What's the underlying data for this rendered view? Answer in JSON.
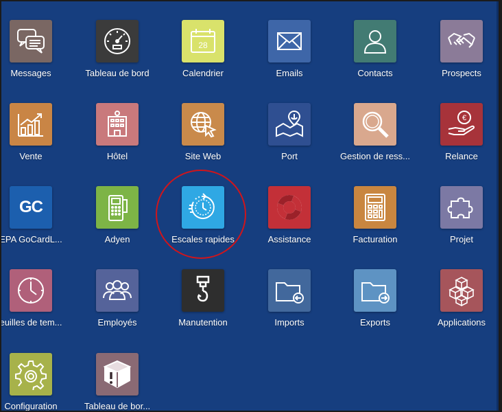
{
  "apps": [
    {
      "label": "Messages",
      "icon": "messages-icon",
      "color": "#7a6763"
    },
    {
      "label": "Tableau de bord",
      "icon": "dashboard-gauge-icon",
      "color": "#3b3b3b"
    },
    {
      "label": "Calendrier",
      "icon": "calendar-icon",
      "color": "#d9e26b",
      "calendar_day": "28"
    },
    {
      "label": "Emails",
      "icon": "email-envelope-icon",
      "color": "#3e66a8"
    },
    {
      "label": "Contacts",
      "icon": "contact-person-icon",
      "color": "#427b73"
    },
    {
      "label": "Prospects",
      "icon": "handshake-icon",
      "color": "#8b7b98"
    },
    {
      "label": "Vente",
      "icon": "sales-chart-icon",
      "color": "#c98545"
    },
    {
      "label": "Hôtel",
      "icon": "hotel-building-icon",
      "color": "#c9797c"
    },
    {
      "label": "Site Web",
      "icon": "globe-cursor-icon",
      "color": "#c98a4b"
    },
    {
      "label": "Port",
      "icon": "port-map-anchor-icon",
      "color": "#2f4f91"
    },
    {
      "label": "Gestion de ress...",
      "icon": "magnifier-icon",
      "color": "#d9a88e"
    },
    {
      "label": "Relance",
      "icon": "euro-hand-icon",
      "color": "#a7333a"
    },
    {
      "label": "EPA GoCardL...",
      "icon": "gocardless-logo-icon",
      "color": "#1c5fae",
      "logo_text": "GC"
    },
    {
      "label": "Adyen",
      "icon": "payment-terminal-icon",
      "color": "#7db446"
    },
    {
      "label": "Escales rapides",
      "icon": "fast-clock-icon",
      "color": "#2fa8e4"
    },
    {
      "label": "Assistance",
      "icon": "lifebuoy-icon",
      "color": "#c33038"
    },
    {
      "label": "Facturation",
      "icon": "calculator-icon",
      "color": "#c98640"
    },
    {
      "label": "Projet",
      "icon": "puzzle-icon",
      "color": "#7c79a4"
    },
    {
      "label": "euilles de tem...",
      "icon": "timesheet-clock-icon",
      "color": "#b0607a"
    },
    {
      "label": "Employés",
      "icon": "employees-group-icon",
      "color": "#55639a"
    },
    {
      "label": "Manutention",
      "icon": "crane-hook-icon",
      "color": "#2e2e2e"
    },
    {
      "label": "Imports",
      "icon": "folder-import-icon",
      "color": "#42689c"
    },
    {
      "label": "Exports",
      "icon": "folder-export-icon",
      "color": "#5e93c3"
    },
    {
      "label": "Applications",
      "icon": "cubes-icon",
      "color": "#a6555b"
    },
    {
      "label": "Configuration",
      "icon": "gear-icon",
      "color": "#a7b24a"
    },
    {
      "label": "Tableau de bor...",
      "icon": "alert-box-icon",
      "color": "#8a6a74"
    }
  ],
  "highlighted_app": "Escales rapides",
  "highlight_color": "#d0151b"
}
